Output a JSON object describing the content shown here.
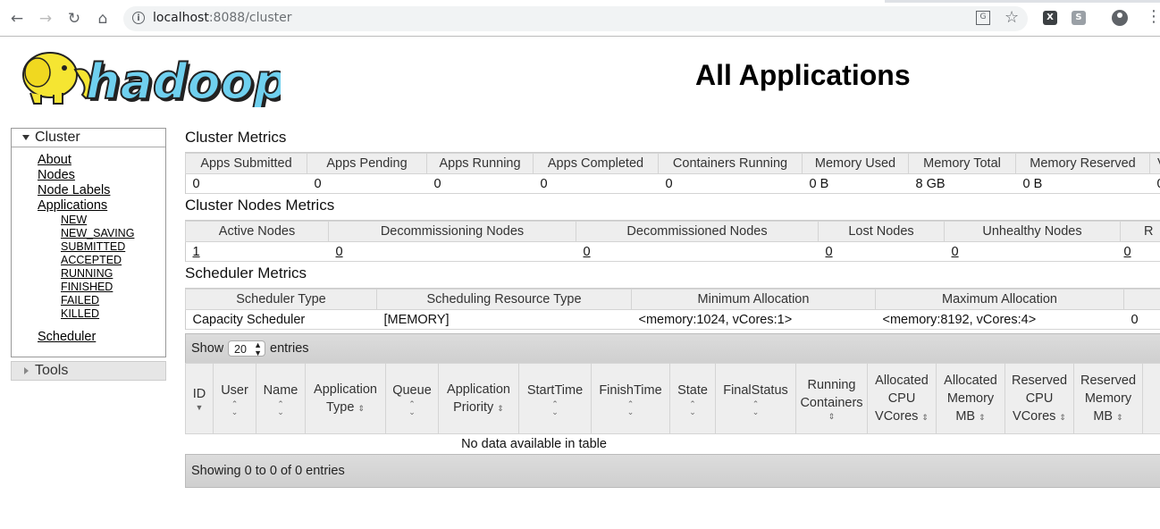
{
  "browser": {
    "url_host": "localhost",
    "url_rest": ":8088/cluster"
  },
  "page": {
    "title": "All Applications"
  },
  "logo": {
    "text": "hadoop"
  },
  "sidebar": {
    "cluster_label": "Cluster",
    "links": [
      "About",
      "Nodes",
      "Node Labels",
      "Applications"
    ],
    "app_states": [
      "NEW",
      "NEW_SAVING",
      "SUBMITTED",
      "ACCEPTED",
      "RUNNING",
      "FINISHED",
      "FAILED",
      "KILLED"
    ],
    "scheduler_label": "Scheduler",
    "tools_label": "Tools"
  },
  "cluster_metrics": {
    "title": "Cluster Metrics",
    "headers": [
      "Apps Submitted",
      "Apps Pending",
      "Apps Running",
      "Apps Completed",
      "Containers Running",
      "Memory Used",
      "Memory Total",
      "Memory Reserved",
      "VC"
    ],
    "values": [
      "0",
      "0",
      "0",
      "0",
      "0",
      "0 B",
      "8 GB",
      "0 B",
      "0"
    ]
  },
  "nodes_metrics": {
    "title": "Cluster Nodes Metrics",
    "headers": [
      "Active Nodes",
      "Decommissioning Nodes",
      "Decommissioned Nodes",
      "Lost Nodes",
      "Unhealthy Nodes",
      "R"
    ],
    "values": [
      "1",
      "0",
      "0",
      "0",
      "0",
      "0"
    ]
  },
  "scheduler_metrics": {
    "title": "Scheduler Metrics",
    "headers": [
      "Scheduler Type",
      "Scheduling Resource Type",
      "Minimum Allocation",
      "Maximum Allocation",
      ""
    ],
    "values": [
      "Capacity Scheduler",
      "[MEMORY]",
      "<memory:1024, vCores:1>",
      "<memory:8192, vCores:4>",
      "0"
    ]
  },
  "apps_table": {
    "show_label": "Show",
    "page_size": "20",
    "entries_label": "entries",
    "columns": [
      [
        "ID"
      ],
      [
        "User"
      ],
      [
        "Name"
      ],
      [
        "Application",
        "Type"
      ],
      [
        "Queue"
      ],
      [
        "Application",
        "Priority"
      ],
      [
        "StartTime"
      ],
      [
        "FinishTime"
      ],
      [
        "State"
      ],
      [
        "FinalStatus"
      ],
      [
        "Running",
        "Containers"
      ],
      [
        "Allocated",
        "CPU",
        "VCores"
      ],
      [
        "Allocated",
        "Memory",
        "MB"
      ],
      [
        "Reserved",
        "CPU",
        "VCores"
      ],
      [
        "Reserved",
        "Memory",
        "MB"
      ]
    ],
    "empty_message": "No data available in table",
    "footer": "Showing 0 to 0 of 0 entries"
  }
}
